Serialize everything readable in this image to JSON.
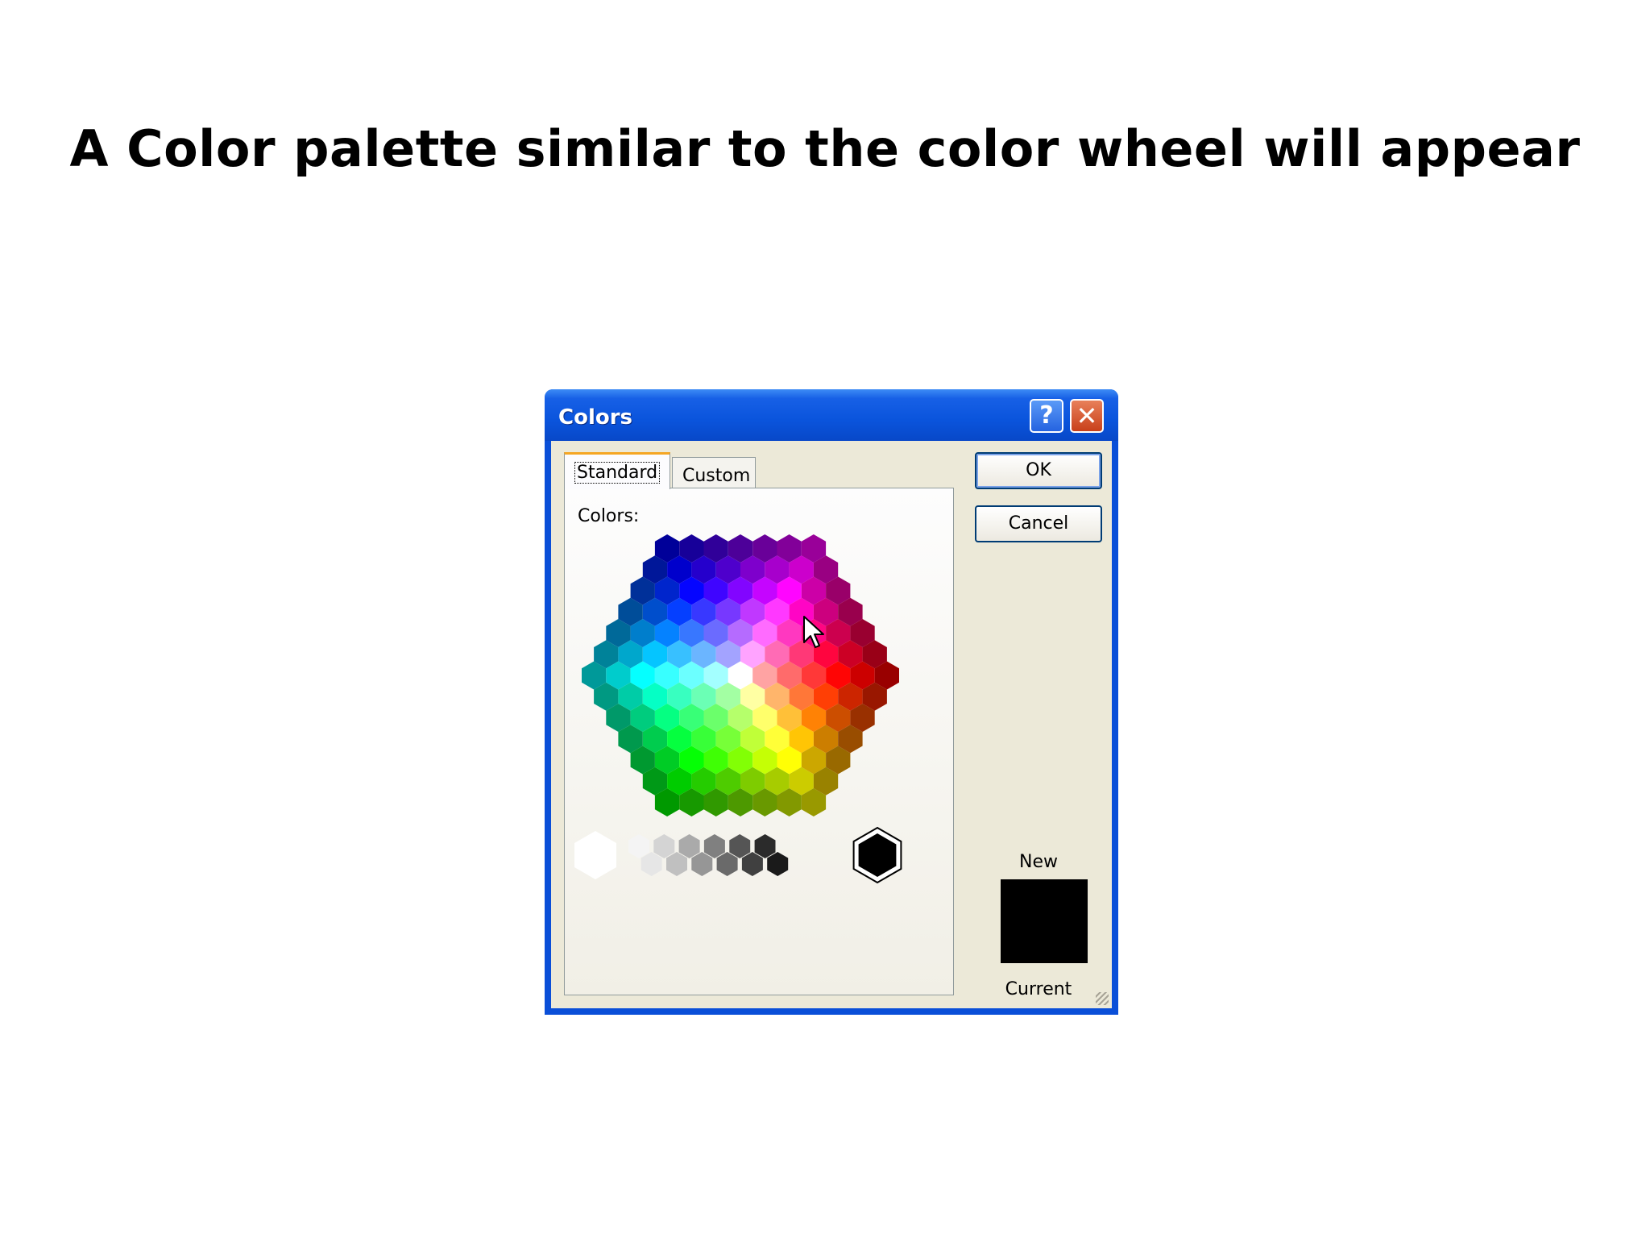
{
  "slide": {
    "title": "A Color palette similar to the color wheel will appear"
  },
  "dialog": {
    "title": "Colors",
    "help_icon": "help-icon",
    "close_icon": "close-icon",
    "tabs": [
      {
        "label": "Standard",
        "selected": true
      },
      {
        "label": "Custom",
        "selected": false
      }
    ],
    "colors_label": "Colors:",
    "ok_label": "OK",
    "cancel_label": "Cancel",
    "new_label": "New",
    "current_label": "Current",
    "new_color": "#000000",
    "selected_swatch": "#000000",
    "grayscale": [
      "#ffffff",
      "#f4f4f4",
      "#e6e6e6",
      "#d4d4d4",
      "#c0c0c0",
      "#aaaaaa",
      "#969696",
      "#808080",
      "#6a6a6a",
      "#555555",
      "#404040",
      "#2b2b2b",
      "#1a1a1a",
      "#000000"
    ]
  }
}
